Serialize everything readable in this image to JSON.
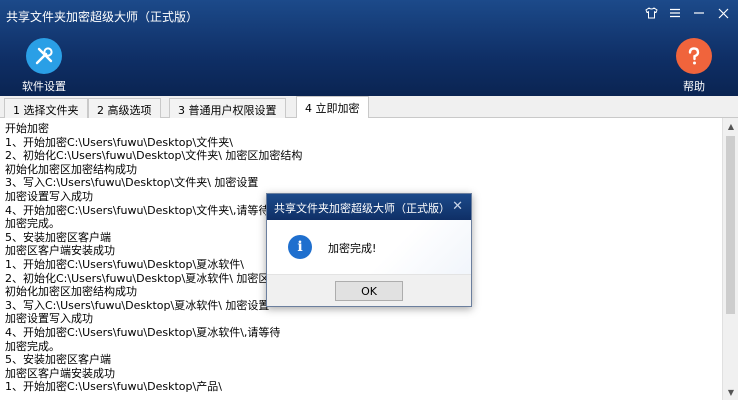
{
  "window": {
    "title": "共享文件夹加密超级大师（正式版）"
  },
  "toolbar": {
    "settings_label": "软件设置",
    "help_label": "帮助"
  },
  "tabs": [
    {
      "label": "1 选择文件夹"
    },
    {
      "label": "2 高级选项"
    },
    {
      "label": "3 普通用户权限设置"
    },
    {
      "label": "4 立即加密"
    }
  ],
  "log": [
    "开始加密",
    "1、开始加密C:\\Users\\fuwu\\Desktop\\文件夹\\",
    "2、初始化C:\\Users\\fuwu\\Desktop\\文件夹\\ 加密区加密结构",
    "初始化加密区加密结构成功",
    "3、写入C:\\Users\\fuwu\\Desktop\\文件夹\\ 加密设置",
    "加密设置写入成功",
    "4、开始加密C:\\Users\\fuwu\\Desktop\\文件夹\\,请等待",
    "加密完成。",
    "5、安装加密区客户端",
    "加密区客户端安装成功",
    "1、开始加密C:\\Users\\fuwu\\Desktop\\夏冰软件\\",
    "2、初始化C:\\Users\\fuwu\\Desktop\\夏冰软件\\ 加密区加密结构",
    "初始化加密区加密结构成功",
    "3、写入C:\\Users\\fuwu\\Desktop\\夏冰软件\\ 加密设置",
    "加密设置写入成功",
    "4、开始加密C:\\Users\\fuwu\\Desktop\\夏冰软件\\,请等待",
    "加密完成。",
    "5、安装加密区客户端",
    "加密区客户端安装成功",
    "1、开始加密C:\\Users\\fuwu\\Desktop\\产品\\"
  ],
  "dialog": {
    "title": "共享文件夹加密超级大师（正式版）",
    "message": "加密完成!",
    "ok_label": "OK"
  }
}
